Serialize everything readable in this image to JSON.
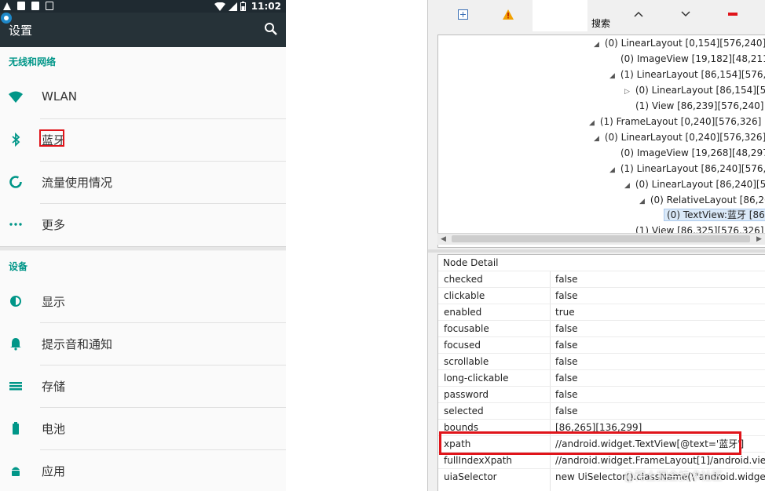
{
  "status_bar": {
    "time": "11:02"
  },
  "app_bar": {
    "title": "设置"
  },
  "sections": {
    "wireless": "无线和网络",
    "device": "设备"
  },
  "settings_items": [
    {
      "label": "WLAN",
      "icon": "wifi-icon"
    },
    {
      "label": "蓝牙",
      "icon": "bluetooth-icon"
    },
    {
      "label": "流量使用情况",
      "icon": "data-usage-icon"
    },
    {
      "label": "更多",
      "icon": "more-icon"
    },
    {
      "label": "显示",
      "icon": "brightness-icon"
    },
    {
      "label": "提示音和通知",
      "icon": "bell-icon"
    },
    {
      "label": "存储",
      "icon": "storage-icon"
    },
    {
      "label": "电池",
      "icon": "battery-icon"
    },
    {
      "label": "应用",
      "icon": "android-icon"
    }
  ],
  "toolbar": {
    "search_label": "搜索"
  },
  "tree": [
    {
      "text": "(0) LinearLayout [0,154][576,240]",
      "toggle": "◢"
    },
    {
      "text": "(0) ImageView [19,182][48,211]",
      "toggle": ""
    },
    {
      "text": "(1) LinearLayout [86,154][576,24",
      "toggle": "◢"
    },
    {
      "text": "(0) LinearLayout [86,154][57",
      "toggle": "▷"
    },
    {
      "text": "(1) View [86,239][576,240]",
      "toggle": ""
    },
    {
      "text": "(1) FrameLayout [0,240][576,326]",
      "toggle": "◢"
    },
    {
      "text": "(0) LinearLayout [0,240][576,326]",
      "toggle": "◢"
    },
    {
      "text": "(0) ImageView [19,268][48,297]",
      "toggle": ""
    },
    {
      "text": "(1) LinearLayout [86,240][576,3",
      "toggle": "◢"
    },
    {
      "text": "(0) LinearLayout [86,240][57",
      "toggle": "◢"
    },
    {
      "text": "(0) RelativeLayout [86,26",
      "toggle": "◢"
    },
    {
      "text": "(0) TextView:蓝牙 [86,",
      "toggle": ""
    },
    {
      "text": "(1) View [86,325][576,326]",
      "toggle": ""
    }
  ],
  "node_detail": {
    "title": "Node Detail",
    "rows": [
      {
        "key": "checked",
        "value": "false"
      },
      {
        "key": "clickable",
        "value": "false"
      },
      {
        "key": "enabled",
        "value": "true"
      },
      {
        "key": "focusable",
        "value": "false"
      },
      {
        "key": "focused",
        "value": "false"
      },
      {
        "key": "scrollable",
        "value": "false"
      },
      {
        "key": "long-clickable",
        "value": "false"
      },
      {
        "key": "password",
        "value": "false"
      },
      {
        "key": "selected",
        "value": "false"
      },
      {
        "key": "bounds",
        "value": "[86,265][136,299]"
      },
      {
        "key": "xpath",
        "value": "//android.widget.TextView[@text='蓝牙']"
      },
      {
        "key": "fullIndexXpath",
        "value": "//android.widget.FrameLayout[1]/android.vie..."
      },
      {
        "key": "uiaSelector",
        "value": "new UiSelector().className(\\\"android.widget"
      }
    ]
  },
  "watermark": "@稀土掘金技术社区",
  "colors": {
    "accent": "#009688",
    "appbar": "#263238",
    "highlight": "#e0141a"
  }
}
